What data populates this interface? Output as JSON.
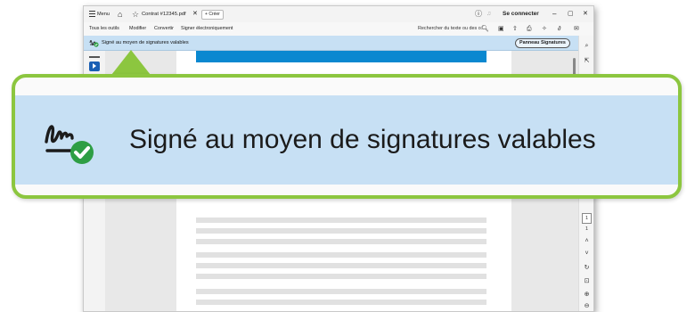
{
  "titlebar": {
    "menu_label": "Menu",
    "tab_name": "Contrat #12345.pdf",
    "new_tab_label": "Créer",
    "connect_label": "Se connecter"
  },
  "toolbar": {
    "items": [
      "Tous les outils",
      "Modifier",
      "Convertir",
      "Signer électroniquement"
    ],
    "search_placeholder": "Rechercher du texte ou des o..."
  },
  "signature_bar": {
    "message": "Signé au moyen de signatures valables",
    "panel_button_label": "Panneau Signatures"
  },
  "page_nav": {
    "current_page": "1",
    "total_pages": "1"
  },
  "colors": {
    "signature_bar_bg": "#c7e0f4",
    "callout_border": "#8cc63f",
    "page_header_band": "#0a88d0",
    "valid_check": "#2e9e44"
  },
  "icons": [
    "home-icon",
    "star-icon",
    "help-icon",
    "bell-icon",
    "search-icon",
    "save-icon",
    "upload-icon",
    "print-icon",
    "ai-assistant-icon",
    "link-icon",
    "email-icon",
    "signature-valid-icon",
    "select-cursor-icon",
    "comment-icon",
    "rotate-icon",
    "zoom-in-icon",
    "zoom-out-icon",
    "scroll-up-icon",
    "scroll-down-icon"
  ]
}
